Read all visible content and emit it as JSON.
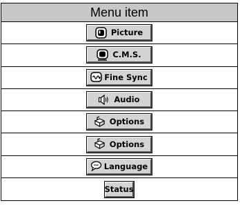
{
  "menu": {
    "header": "Menu item",
    "items": [
      {
        "label": "Picture",
        "icon": "tv-picture-icon"
      },
      {
        "label": "C.M.S.",
        "icon": "tv-cms-icon"
      },
      {
        "label": "Fine Sync",
        "icon": "fine-sync-icon"
      },
      {
        "label": "Audio",
        "icon": "speaker-icon"
      },
      {
        "label": "Options",
        "icon": "options-box-icon"
      },
      {
        "label": "Options",
        "icon": "options-box-icon"
      },
      {
        "label": "Language",
        "icon": "speech-bubble-icon"
      },
      {
        "label": "Status",
        "icon": ""
      }
    ]
  }
}
